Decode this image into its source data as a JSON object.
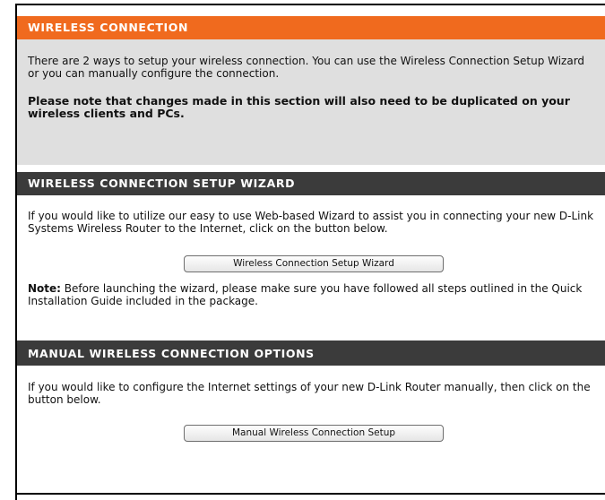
{
  "sections": {
    "wireless": {
      "title": "WIRELESS CONNECTION",
      "intro": "There are 2 ways to setup your wireless connection. You can use the Wireless Connection Setup Wizard or you can manually configure the connection.",
      "note": "Please note that changes made in this section will also need to be duplicated on your wireless clients and PCs."
    },
    "wizard": {
      "title": "WIRELESS CONNECTION SETUP WIZARD",
      "text": "If you would like to utilize our easy to use Web-based Wizard to assist you in connecting your new D-Link Systems Wireless Router to the Internet, click on the button below.",
      "button_label": "Wireless Connection Setup Wizard",
      "note_label": "Note:",
      "note_text": " Before launching the wizard, please make sure you have followed all steps outlined in the Quick Installation Guide included in the package."
    },
    "manual": {
      "title": "MANUAL WIRELESS CONNECTION OPTIONS",
      "text": "If you would like to configure the Internet settings of your new D-Link Router manually, then click on the button below.",
      "button_label": "Manual Wireless Connection Setup"
    }
  },
  "colors": {
    "orange_header": "#f06a1e",
    "dark_header": "#3b3b3b",
    "intro_background": "#dfdfdf"
  }
}
